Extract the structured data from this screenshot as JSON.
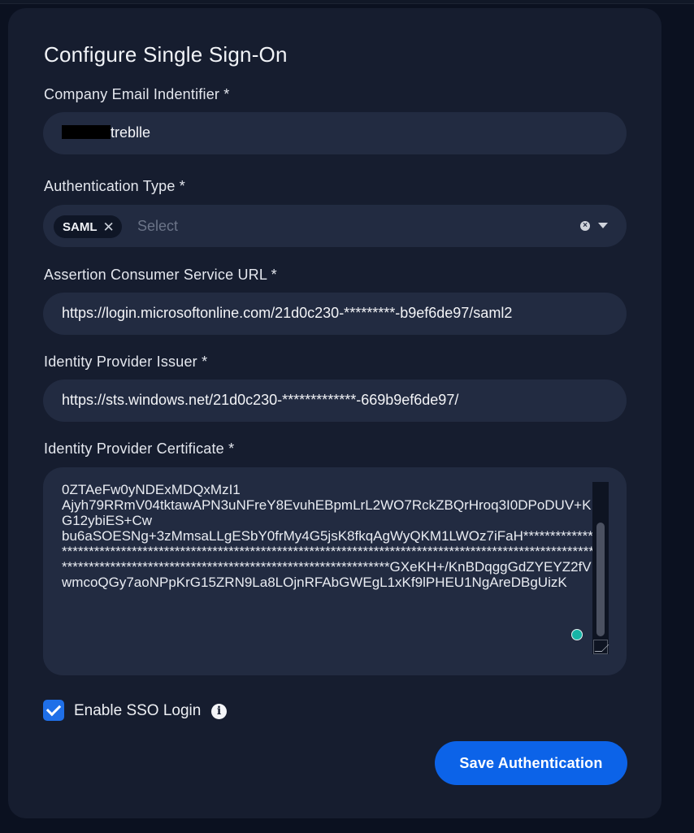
{
  "form": {
    "title": "Configure Single Sign-On",
    "email": {
      "label": "Company Email Indentifier *",
      "value": "treblle"
    },
    "auth_type": {
      "label": "Authentication Type *",
      "selected_chip": "SAML",
      "chip_remove": "✕",
      "placeholder": "Select"
    },
    "acs_url": {
      "label": "Assertion Consumer Service URL *",
      "value": "https://login.microsoftonline.com/21d0c230-*********-b9ef6de97/saml2"
    },
    "issuer": {
      "label": "Identity Provider Issuer *",
      "value": "https://sts.windows.net/21d0c230-*************-669b9ef6de97/"
    },
    "certificate": {
      "label": "Identity Provider Certificate *",
      "value": "0ZTAeFw0yNDExMDQxMzI1\nAjyh79RRmV04tktawAPN3uNFreY8EvuhEBpmLrL2WO7RckZBQrHroq3I0DPoDUV+KG12ybiES+Cw\nbu6aSOESNg+3zMmsaLLgESbY0frMy4G5jsK8fkqAgWyQKM1LWOz7iFaH*****************************************************************************************************************************************************************************GXeKH+/KnBDqggGdZYEYZ2fVwmcoQGy7aoNPpKrG15ZRN9La8LOjnRFAbGWEgL1xKf9lPHEU1NgAreDBgUizK"
    },
    "enable_sso": {
      "label": "Enable SSO Login",
      "checked": true
    },
    "save_label": "Save Authentication"
  },
  "colors": {
    "accent": "#0c63e8",
    "background": "#0b1120",
    "card": "#161d2f",
    "input": "#222b41"
  },
  "icons": {
    "chip_remove": "close-icon",
    "clear": "clear-icon",
    "dropdown": "chevron-down-icon",
    "info": "info-icon",
    "check": "check-icon"
  }
}
